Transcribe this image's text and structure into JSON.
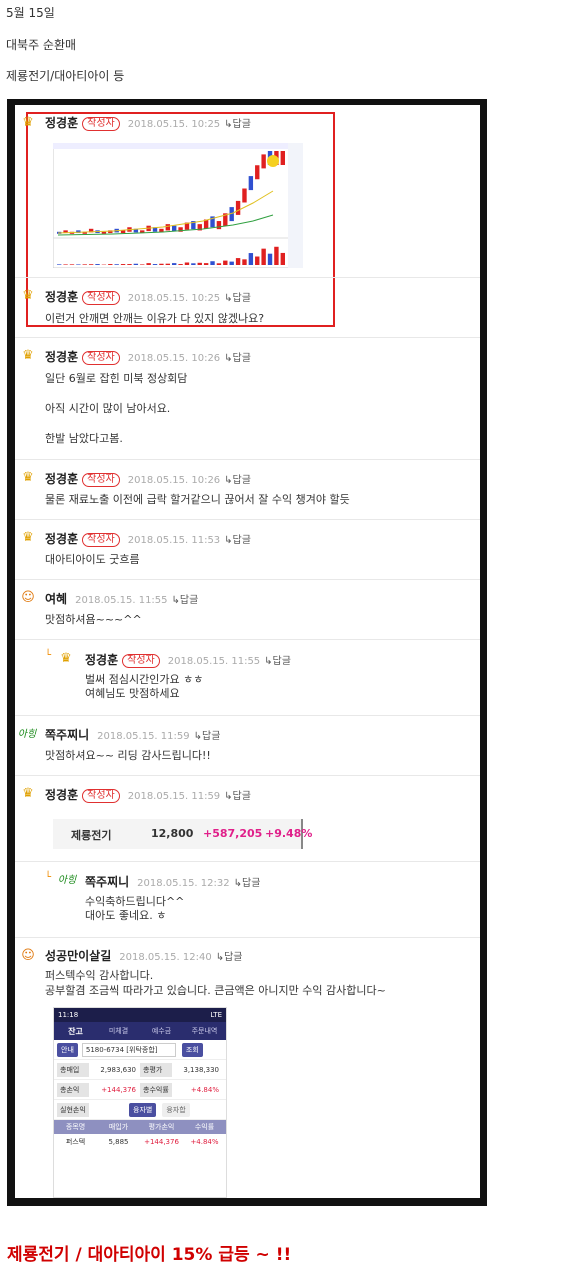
{
  "post": {
    "date": "5월 15일",
    "topic": "대북주 순환매",
    "stocks": "제룡전기/대아티아이 등",
    "headline": "제룡전기 / 대아티아이 15% 급등 ~ !!"
  },
  "reply_label": "↳답글",
  "comments": [
    {
      "nick": "정경훈",
      "badge": "작성자",
      "date": "2018.05.15. 10:25",
      "lines": []
    },
    {
      "nick": "정경훈",
      "badge": "작성자",
      "date": "2018.05.15. 10:25",
      "lines": [
        "이런거 안깨면 안깨는 이유가 다 있지 않겠나요?"
      ]
    },
    {
      "nick": "정경훈",
      "badge": "작성자",
      "date": "2018.05.15. 10:26",
      "lines": [
        "일단 6월로 잡힌 미북 정상회담",
        "아직 시간이 많이 남아서요.",
        "한발 남았다고봄."
      ]
    },
    {
      "nick": "정경훈",
      "badge": "작성자",
      "date": "2018.05.15. 10:26",
      "lines": [
        "물론 재료노출 이전에 급락 할거같으니 끊어서 잘 수익 챙겨야 할듯"
      ]
    },
    {
      "nick": "정경훈",
      "badge": "작성자",
      "date": "2018.05.15. 11:53",
      "lines": [
        "대아티아이도 굿흐름"
      ]
    },
    {
      "nick": "여혜",
      "badge": "",
      "date": "2018.05.15. 11:55",
      "lines": [
        "맛점하셔욤~~~^^"
      ]
    },
    {
      "nick": "정경훈",
      "badge": "작성자",
      "date": "2018.05.15. 11:55",
      "lines": [
        "벌써 점심시간인가요 ㅎㅎ",
        "여혜님도 맛점하세요"
      ]
    },
    {
      "nick": "쪽주찌니",
      "badge": "",
      "date": "2018.05.15. 11:59",
      "lines": [
        "맛점하셔요~~ 리딩 감사드립니다!!"
      ]
    },
    {
      "nick": "정경훈",
      "badge": "작성자",
      "date": "2018.05.15. 11:59",
      "lines": []
    },
    {
      "nick": "쪽주찌니",
      "badge": "",
      "date": "2018.05.15. 12:32",
      "lines": [
        "수익축하드립니다^^",
        "대아도 좋네요. ㅎ"
      ]
    },
    {
      "nick": "성공만이살길",
      "badge": "",
      "date": "2018.05.15. 12:40",
      "lines": [
        "퍼스텍수익 감사합니다.",
        "공부할겸 조금씩 따라가고 있습니다. 큰금액은 아니지만 수익 감사합니다~"
      ]
    }
  ],
  "stock_quote": {
    "name": "제룡전기",
    "price": "12,800",
    "change": "+587,205",
    "pct": "+9.48%"
  },
  "app": {
    "time": "11:18",
    "status": "LTE",
    "tabs": [
      "잔고",
      "미체결",
      "예수금",
      "주문내역"
    ],
    "account_label": "안내",
    "account": "5180-6734 [위탁종합]",
    "query": "조회",
    "rows": [
      {
        "l1": "총매입",
        "v1": "2,983,630",
        "l2": "총평가",
        "v2": "3,138,330"
      },
      {
        "l1": "총손익",
        "v1": "+144,376",
        "l2": "총수익률",
        "v2": "+4.84%"
      }
    ],
    "realized": "실현손익",
    "btn1": "융자별",
    "btn2": "융자합",
    "headers": [
      "종목명",
      "매입가",
      "평가손익",
      "수익률"
    ],
    "holding": [
      "퍼스텍",
      "5,885",
      "+144,376",
      "+4.84%"
    ]
  },
  "chart_thumb": {
    "type": "bar",
    "bars": [
      2,
      3,
      2,
      3,
      2,
      4,
      3,
      2,
      3,
      4,
      3,
      5,
      4,
      3,
      6,
      5,
      4,
      7,
      6,
      5,
      8,
      9,
      7,
      10,
      12,
      9,
      14,
      18,
      22,
      30,
      38,
      45,
      52,
      60,
      58,
      64
    ]
  }
}
